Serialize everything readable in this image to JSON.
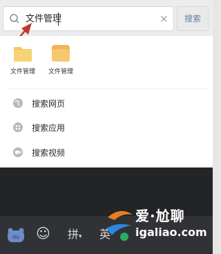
{
  "search": {
    "query": "文件管理",
    "clear_icon": "×",
    "button_label": "搜索"
  },
  "apps": [
    {
      "label": "文件管理",
      "icon": "folder-icon"
    },
    {
      "label": "文件管理",
      "icon": "folder-icon"
    }
  ],
  "actions": [
    {
      "label": "搜索网页",
      "icon": "globe-icon"
    },
    {
      "label": "搜索应用",
      "icon": "apps-icon"
    },
    {
      "label": "搜索视频",
      "icon": "video-icon"
    }
  ],
  "keyboard": {
    "pinyin_label": "拼",
    "english_label": "英",
    "emoji_icon": "☺"
  },
  "watermark": {
    "title": "爱·尬聊",
    "url": "igaliao.com"
  },
  "colors": {
    "folder_yellow": "#f4c65a",
    "keyboard_bg": "#303235",
    "arrow_red": "#c0392b"
  }
}
